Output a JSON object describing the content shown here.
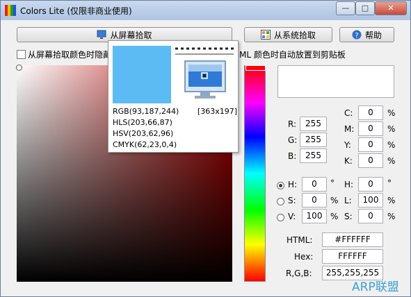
{
  "window": {
    "title": "Colors Lite (仅限非商业使用)"
  },
  "titlebar_buttons": {
    "minimize": "—",
    "maximize": "□",
    "close": "✕"
  },
  "toolbar": {
    "screen_pick": "从屏幕拾取",
    "system_pick": "从系统拾取",
    "help": "帮助"
  },
  "options": {
    "hide_on_pick": "从屏幕拾取颜色时隐藏",
    "clipboard_suffix": "ML 颜色时自动放置到剪贴板"
  },
  "popup": {
    "rgb": "RGB(93,187,244)",
    "coords": "[363x197]",
    "hls": "HLS(203,66,87)",
    "hsv": "HSV(203,62,96)",
    "cmyk": "CMYK(62,23,0,4)",
    "swatch_color": "#5dbbf4"
  },
  "rgb": {
    "r_label": "R:",
    "r": "255",
    "g_label": "G:",
    "g": "255",
    "b_label": "B:",
    "b": "255"
  },
  "cmyk": {
    "c_label": "C:",
    "c": "0",
    "m_label": "M:",
    "m": "0",
    "y_label": "Y:",
    "y": "0",
    "k_label": "K:",
    "k": "0",
    "unit": "%"
  },
  "hsv": {
    "h_label": "H:",
    "h": "0",
    "s_label": "S:",
    "s": "0",
    "v_label": "V:",
    "v": "100",
    "deg": "°",
    "unit": "%"
  },
  "hls": {
    "h_label": "H:",
    "h": "0",
    "l_label": "L:",
    "l": "100",
    "s_label": "S:",
    "s": "0",
    "deg": "°",
    "unit": "%"
  },
  "output": {
    "html_label": "HTML:",
    "html": "#FFFFFF",
    "hex_label": "Hex:",
    "hex": "FFFFFF",
    "rgb_label": "R,G,B:",
    "rgb": "255,255,255"
  },
  "watermark": {
    "text": "ARP联盟"
  }
}
